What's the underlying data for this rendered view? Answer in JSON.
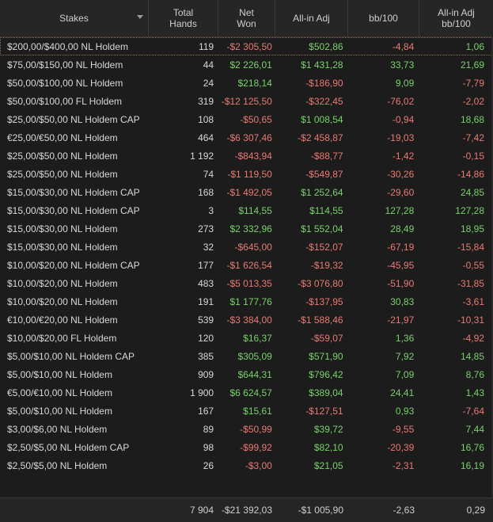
{
  "header": {
    "stakes": "Stakes",
    "total_hands": "Total\nHands",
    "net_won": "Net\nWon",
    "allin_adj": "All-in Adj",
    "bb100": "bb/100",
    "allin_adj_bb100": "All-in Adj\nbb/100"
  },
  "rows": [
    {
      "stakes": "$200,00/$400,00 NL Holdem",
      "hands": "119",
      "won": "-$2 305,50",
      "adj": "$502,86",
      "bb": "-4,84",
      "adjbb": "1,06"
    },
    {
      "stakes": "$75,00/$150,00 NL Holdem",
      "hands": "44",
      "won": "$2 226,01",
      "adj": "$1 431,28",
      "bb": "33,73",
      "adjbb": "21,69"
    },
    {
      "stakes": "$50,00/$100,00 NL Holdem",
      "hands": "24",
      "won": "$218,14",
      "adj": "-$186,90",
      "bb": "9,09",
      "adjbb": "-7,79"
    },
    {
      "stakes": "$50,00/$100,00 FL Holdem",
      "hands": "319",
      "won": "-$12 125,50",
      "adj": "-$322,45",
      "bb": "-76,02",
      "adjbb": "-2,02"
    },
    {
      "stakes": "$25,00/$50,00 NL Holdem CAP",
      "hands": "108",
      "won": "-$50,65",
      "adj": "$1 008,54",
      "bb": "-0,94",
      "adjbb": "18,68"
    },
    {
      "stakes": "€25,00/€50,00 NL Holdem",
      "hands": "464",
      "won": "-$6 307,46",
      "adj": "-$2 458,87",
      "bb": "-19,03",
      "adjbb": "-7,42"
    },
    {
      "stakes": "$25,00/$50,00 NL Holdem",
      "hands": "1 192",
      "won": "-$843,94",
      "adj": "-$88,77",
      "bb": "-1,42",
      "adjbb": "-0,15"
    },
    {
      "stakes": "$25,00/$50,00 NL Holdem",
      "hands": "74",
      "won": "-$1 119,50",
      "adj": "-$549,87",
      "bb": "-30,26",
      "adjbb": "-14,86"
    },
    {
      "stakes": "$15,00/$30,00 NL Holdem CAP",
      "hands": "168",
      "won": "-$1 492,05",
      "adj": "$1 252,64",
      "bb": "-29,60",
      "adjbb": "24,85"
    },
    {
      "stakes": "$15,00/$30,00 NL Holdem CAP",
      "hands": "3",
      "won": "$114,55",
      "adj": "$114,55",
      "bb": "127,28",
      "adjbb": "127,28"
    },
    {
      "stakes": "$15,00/$30,00 NL Holdem",
      "hands": "273",
      "won": "$2 332,96",
      "adj": "$1 552,04",
      "bb": "28,49",
      "adjbb": "18,95"
    },
    {
      "stakes": "$15,00/$30,00 NL Holdem",
      "hands": "32",
      "won": "-$645,00",
      "adj": "-$152,07",
      "bb": "-67,19",
      "adjbb": "-15,84"
    },
    {
      "stakes": "$10,00/$20,00 NL Holdem CAP",
      "hands": "177",
      "won": "-$1 626,54",
      "adj": "-$19,32",
      "bb": "-45,95",
      "adjbb": "-0,55"
    },
    {
      "stakes": "$10,00/$20,00 NL Holdem",
      "hands": "483",
      "won": "-$5 013,35",
      "adj": "-$3 076,80",
      "bb": "-51,90",
      "adjbb": "-31,85"
    },
    {
      "stakes": "$10,00/$20,00 NL Holdem",
      "hands": "191",
      "won": "$1 177,76",
      "adj": "-$137,95",
      "bb": "30,83",
      "adjbb": "-3,61"
    },
    {
      "stakes": "€10,00/€20,00 NL Holdem",
      "hands": "539",
      "won": "-$3 384,00",
      "adj": "-$1 588,46",
      "bb": "-21,97",
      "adjbb": "-10,31"
    },
    {
      "stakes": "$10,00/$20,00 FL Holdem",
      "hands": "120",
      "won": "$16,37",
      "adj": "-$59,07",
      "bb": "1,36",
      "adjbb": "-4,92"
    },
    {
      "stakes": "$5,00/$10,00 NL Holdem CAP",
      "hands": "385",
      "won": "$305,09",
      "adj": "$571,90",
      "bb": "7,92",
      "adjbb": "14,85"
    },
    {
      "stakes": "$5,00/$10,00 NL Holdem",
      "hands": "909",
      "won": "$644,31",
      "adj": "$796,42",
      "bb": "7,09",
      "adjbb": "8,76"
    },
    {
      "stakes": "€5,00/€10,00 NL Holdem",
      "hands": "1 900",
      "won": "$6 624,57",
      "adj": "$389,04",
      "bb": "24,41",
      "adjbb": "1,43"
    },
    {
      "stakes": "$5,00/$10,00 NL Holdem",
      "hands": "167",
      "won": "$15,61",
      "adj": "-$127,51",
      "bb": "0,93",
      "adjbb": "-7,64"
    },
    {
      "stakes": "$3,00/$6,00 NL Holdem",
      "hands": "89",
      "won": "-$50,99",
      "adj": "$39,72",
      "bb": "-9,55",
      "adjbb": "7,44"
    },
    {
      "stakes": "$2,50/$5,00 NL Holdem CAP",
      "hands": "98",
      "won": "-$99,92",
      "adj": "$82,10",
      "bb": "-20,39",
      "adjbb": "16,76"
    },
    {
      "stakes": "$2,50/$5,00 NL Holdem",
      "hands": "26",
      "won": "-$3,00",
      "adj": "$21,05",
      "bb": "-2,31",
      "adjbb": "16,19"
    }
  ],
  "totals": {
    "hands": "7 904",
    "won": "-$21 392,03",
    "adj": "-$1 005,90",
    "bb": "-2,63",
    "adjbb": "0,29"
  },
  "colors": {
    "positive": "#78d26a",
    "negative": "#e97a72",
    "background": "#1c1c1c",
    "header": "#262626"
  },
  "icons": {
    "sort": "sort-desc-icon"
  }
}
